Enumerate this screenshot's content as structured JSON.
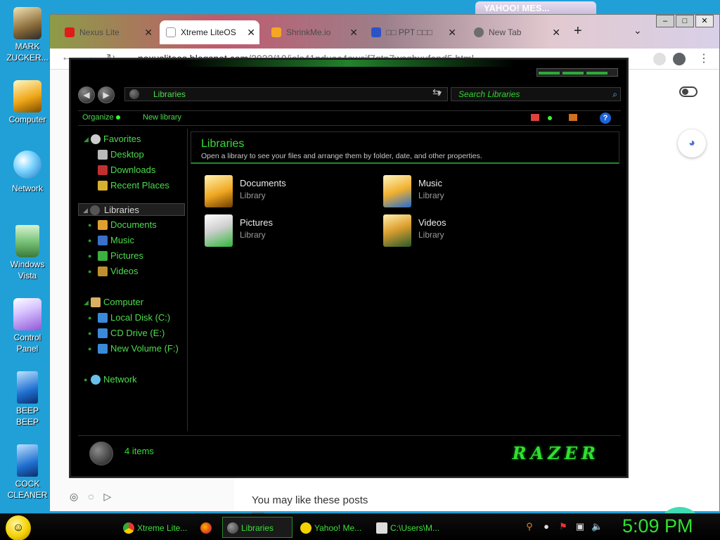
{
  "desktop": {
    "icons": [
      {
        "label": "MARK ZUCKER...",
        "icon": "person-photo-icon"
      },
      {
        "label": "Computer",
        "icon": "computer-icon"
      },
      {
        "label": "Network",
        "icon": "network-globe-icon"
      },
      {
        "label": "Windows Vista",
        "icon": "recycle-bin-icon"
      },
      {
        "label": "Control Panel",
        "icon": "control-panel-icon"
      },
      {
        "label": "BEEP BEEP",
        "icon": "blue-document-icon"
      },
      {
        "label": "COCK CLEANER",
        "icon": "blue-document-icon"
      }
    ],
    "yahoo_peek": "YAHOO! MES..."
  },
  "browser": {
    "tabs": [
      {
        "label": "Nexus Lite",
        "icon": "youtube-icon",
        "active": false
      },
      {
        "label": "Xtreme LiteOS",
        "icon": "blogger-icon",
        "active": true
      },
      {
        "label": "ShrinkMe.io",
        "icon": "shrinkme-icon",
        "active": false
      },
      {
        "label": "□□ PPT □□□",
        "icon": "ppt-icon",
        "active": false
      },
      {
        "label": "New Tab",
        "icon": "chrome-icon",
        "active": false
      }
    ],
    "url_host": "nexusliteos.blogspot.com",
    "url_path": "/2022/10/iols41nduoc4owcif7gtp7wsgbxufond5.html",
    "page": {
      "related": "You may like these posts"
    },
    "colors": {
      "accent": "#40dcb4"
    }
  },
  "explorer": {
    "address": "Libraries",
    "search_placeholder": "Search Libraries",
    "commands": {
      "organize": "Organize",
      "new_library": "New library"
    },
    "nav": {
      "favorites": "Favorites",
      "favorites_items": [
        "Desktop",
        "Downloads",
        "Recent Places"
      ],
      "libraries": "Libraries",
      "libraries_items": [
        "Documents",
        "Music",
        "Pictures",
        "Videos"
      ],
      "computer": "Computer",
      "computer_items": [
        "Local Disk (C:)",
        "CD Drive (E:)",
        "New Volume (F:)"
      ],
      "network": "Network"
    },
    "header": {
      "title": "Libraries",
      "subtitle": "Open a library to see your files and arrange them by folder, date, and other properties."
    },
    "libraries": [
      {
        "name": "Documents",
        "type": "Library"
      },
      {
        "name": "Music",
        "type": "Library"
      },
      {
        "name": "Pictures",
        "type": "Library"
      },
      {
        "name": "Videos",
        "type": "Library"
      }
    ],
    "status": "4 items",
    "brand": "RAZER",
    "colors": {
      "text_green": "#31e031",
      "background": "#000000"
    }
  },
  "taskbar": {
    "items": [
      {
        "label": "Xtreme Lite...",
        "icon": "chrome-icon"
      },
      {
        "label": "",
        "icon": "firefox-icon"
      },
      {
        "label": "Libraries",
        "icon": "explorer-orb-icon",
        "active": true
      },
      {
        "label": "Yahoo! Me...",
        "icon": "yahoo-smiley-icon"
      },
      {
        "label": "C:\\Users\\M...",
        "icon": "7zip-icon"
      }
    ],
    "clock": "5:09 PM"
  }
}
